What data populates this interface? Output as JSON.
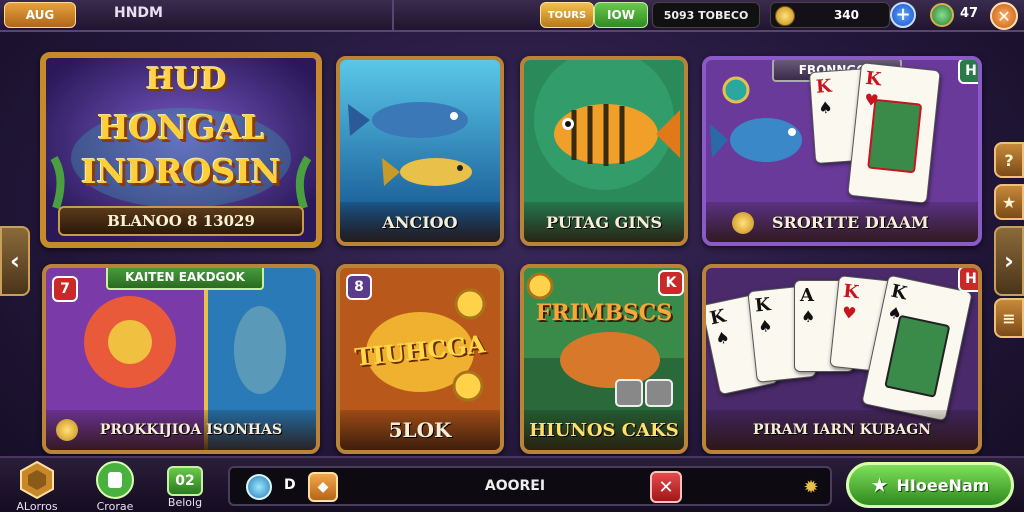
{
  "topbar": {
    "aug_label": "AUG",
    "hud_title": "HNDM",
    "tours_label": "TOURS",
    "now_label": "IOW",
    "tb_label": "5093 TOBECO",
    "coins": "340",
    "plus": "+",
    "gems": "47",
    "close": "✕"
  },
  "hero": {
    "badge": "HUD",
    "title_1": "HONGAL",
    "title_2": "INDROSIN",
    "footer": "BLANOO 8 13029"
  },
  "cards": {
    "c1": {
      "label": "ANCIOO"
    },
    "c2": {
      "label": "PUTAG GINS"
    },
    "c3": {
      "label": "SRORTTE DIAAM",
      "tag": "FBONNGOX",
      "badge": "H"
    },
    "c4": {
      "label": "PROKKIJIOA ISONHAS",
      "banner": "KAITEN EAKDGOK",
      "badge": "7"
    },
    "c5": {
      "label": "5LOK",
      "title": "TIUHCGA",
      "badge": "8"
    },
    "c6": {
      "label": "HIUNOS CAKS",
      "title": "FRIMBSCS",
      "badge": "K"
    },
    "c7": {
      "label": "PIRAM IARN KUBAGN",
      "badge": "H"
    }
  },
  "cards_ranks": [
    "K",
    "K",
    "A",
    "K",
    "K"
  ],
  "nav": {
    "left_arrow": "‹",
    "right_arrow": "›",
    "side_1": "?",
    "side_2": "★"
  },
  "bottom": {
    "nav1_label": "ALorros",
    "nav2_label": "Crorae",
    "nav3_label": "Belolg",
    "nav3_icon": "02",
    "chat_d": "D",
    "chat_text": "AOOREI",
    "chat_x": "✕",
    "cta_label": "HIoeeNam"
  }
}
